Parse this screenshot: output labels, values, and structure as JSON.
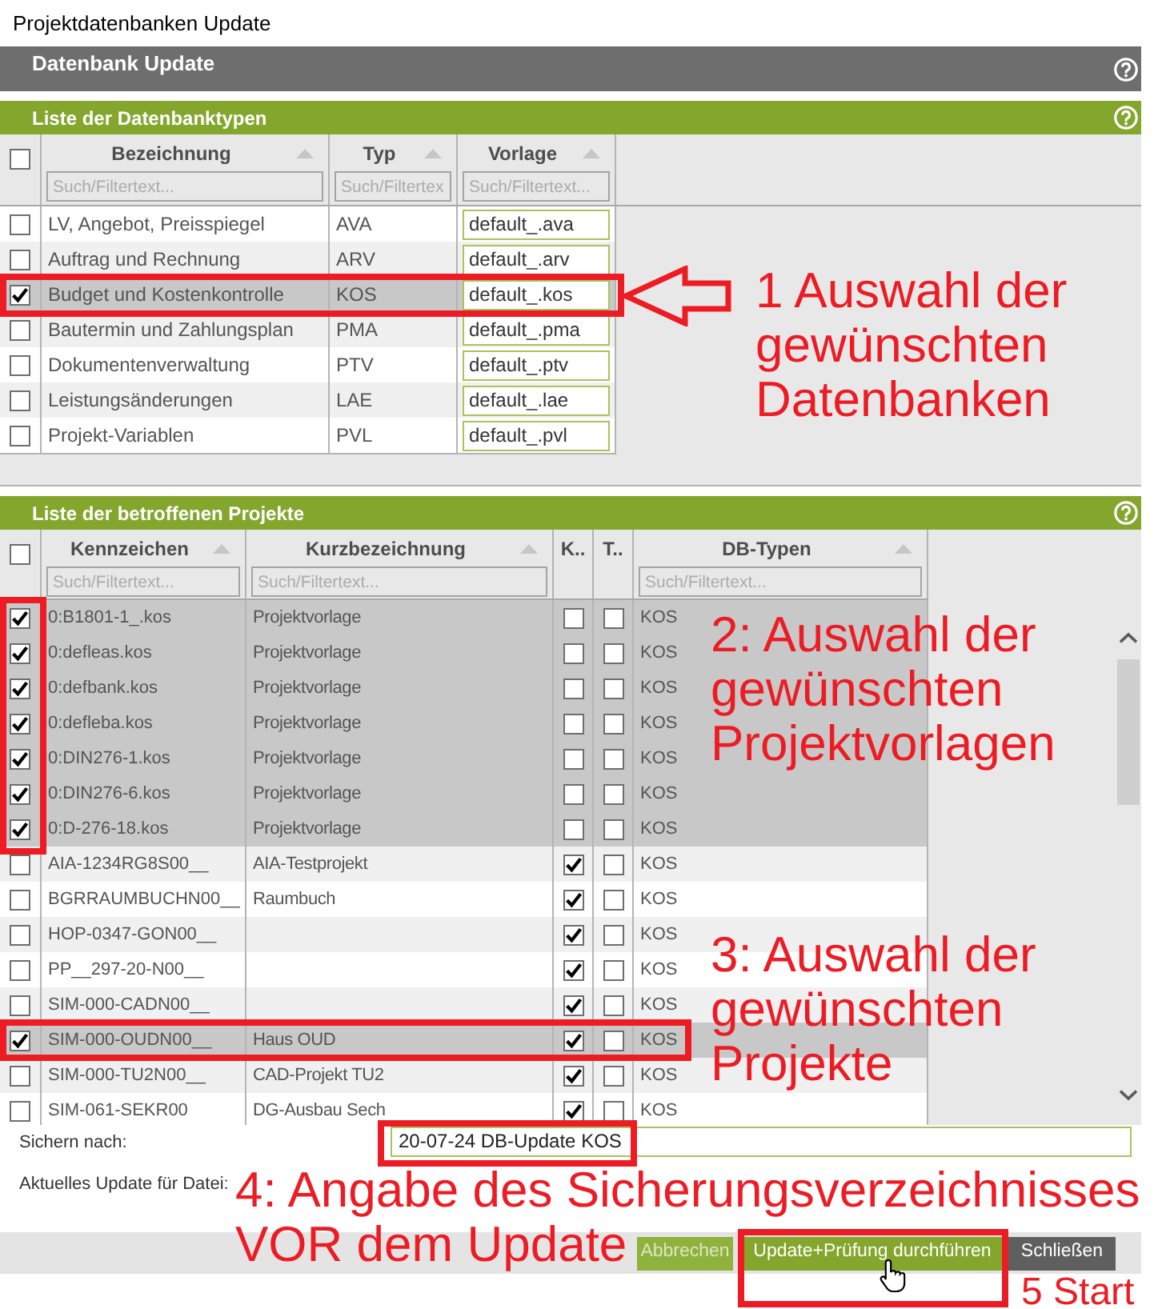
{
  "window": {
    "title": "Projektdatenbanken Update"
  },
  "header": {
    "title": "Datenbank Update"
  },
  "database_types": {
    "title": "Liste der Datenbanktypen",
    "select_all": {
      "checked": false
    },
    "columns": [
      {
        "label": "Bezeichnung",
        "sortable": true,
        "placeholder": "Such/Filtertext..."
      },
      {
        "label": "Typ",
        "sortable": true,
        "placeholder": "Such/Filtertex"
      },
      {
        "label": "Vorlage",
        "sortable": true,
        "placeholder": "Such/Filtertext..."
      }
    ],
    "rows": [
      {
        "name": "LV, Angebot, Preisspiegel",
        "type": "AVA",
        "template": "default_.ava",
        "checked": false,
        "selected": false
      },
      {
        "name": "Auftrag und Rechnung",
        "type": "ARV",
        "template": "default_.arv",
        "checked": false,
        "selected": false
      },
      {
        "name": "Budget und Kostenkontrolle",
        "type": "KOS",
        "template": "default_.kos",
        "checked": true,
        "selected": true
      },
      {
        "name": "Bautermin und Zahlungsplan",
        "type": "PMA",
        "template": "default_.pma",
        "checked": false,
        "selected": false
      },
      {
        "name": "Dokumentenverwaltung",
        "type": "PTV",
        "template": "default_.ptv",
        "checked": false,
        "selected": false
      },
      {
        "name": "Leistungsänderungen",
        "type": "LAE",
        "template": "default_.lae",
        "checked": false,
        "selected": false
      },
      {
        "name": "Projekt-Variablen",
        "type": "PVL",
        "template": "default_.pvl",
        "checked": false,
        "selected": false
      }
    ]
  },
  "projects": {
    "title": "Liste der betroffenen Projekte",
    "select_all": {
      "checked": false
    },
    "columns": [
      {
        "label": "Kennzeichen",
        "sortable": true,
        "placeholder": "Such/Filtertext..."
      },
      {
        "label": "Kurzbezeichnung",
        "sortable": true,
        "placeholder": "Such/Filtertext..."
      },
      {
        "label": "K..",
        "sortable": false
      },
      {
        "label": "T..",
        "sortable": false
      },
      {
        "label": "DB-Typen",
        "sortable": true,
        "placeholder": "Such/Filtertext..."
      }
    ],
    "rows": [
      {
        "code": "0:B1801-1_.kos",
        "short_name": "Projektvorlage",
        "column_k": false,
        "column_t": false,
        "db_types": "KOS",
        "checked": true,
        "selected": true
      },
      {
        "code": "0:defleas.kos",
        "short_name": "Projektvorlage",
        "column_k": false,
        "column_t": false,
        "db_types": "KOS",
        "checked": true,
        "selected": true
      },
      {
        "code": "0:defbank.kos",
        "short_name": "Projektvorlage",
        "column_k": false,
        "column_t": false,
        "db_types": "KOS",
        "checked": true,
        "selected": true
      },
      {
        "code": "0:defleba.kos",
        "short_name": "Projektvorlage",
        "column_k": false,
        "column_t": false,
        "db_types": "KOS",
        "checked": true,
        "selected": true
      },
      {
        "code": "0:DIN276-1.kos",
        "short_name": "Projektvorlage",
        "column_k": false,
        "column_t": false,
        "db_types": "KOS",
        "checked": true,
        "selected": true
      },
      {
        "code": "0:DIN276-6.kos",
        "short_name": "Projektvorlage",
        "column_k": false,
        "column_t": false,
        "db_types": "KOS",
        "checked": true,
        "selected": true
      },
      {
        "code": "0:D-276-18.kos",
        "short_name": "Projektvorlage",
        "column_k": false,
        "column_t": false,
        "db_types": "KOS",
        "checked": true,
        "selected": true
      },
      {
        "code": "AIA-1234RG8S00__",
        "short_name": "AIA-Testprojekt",
        "column_k": true,
        "column_t": false,
        "db_types": "KOS",
        "checked": false,
        "selected": false
      },
      {
        "code": "BGRRAUMBUCHN00__",
        "short_name": "Raumbuch",
        "column_k": true,
        "column_t": false,
        "db_types": "KOS",
        "checked": false,
        "selected": false
      },
      {
        "code": "HOP-0347-GON00__",
        "column_k": true,
        "column_t": false,
        "db_types": "KOS",
        "checked": false,
        "selected": false
      },
      {
        "code": "PP__297-20-N00__",
        "column_k": true,
        "column_t": false,
        "db_types": "KOS",
        "checked": false,
        "selected": false
      },
      {
        "code": "SIM-000-CADN00__",
        "column_k": true,
        "column_t": false,
        "db_types": "KOS",
        "checked": false,
        "selected": false
      },
      {
        "code": "SIM-000-OUDN00__",
        "short_name": "Haus OUD",
        "column_k": true,
        "column_t": false,
        "db_types": "KOS",
        "checked": true,
        "selected": true
      },
      {
        "code": "SIM-000-TU2N00__",
        "short_name": "CAD-Projekt TU2",
        "column_k": true,
        "column_t": false,
        "db_types": "KOS",
        "checked": false,
        "selected": false
      },
      {
        "code": "SIM-061-SEKR00",
        "short_name": "DG-Ausbau Sech",
        "column_k": true,
        "column_t": false,
        "db_types": "KOS",
        "checked": false,
        "selected": false
      }
    ]
  },
  "backup": {
    "label": "Sichern nach:",
    "value": "20-07-24 DB-Update KOS"
  },
  "current_file": {
    "label": "Aktuelles Update für Datei:"
  },
  "buttons": [
    {
      "label": "Abbrechen",
      "kind": "primary",
      "disabled": true
    },
    {
      "label": "Update+Prüfung durchführen",
      "kind": "primary",
      "disabled": false
    },
    {
      "label": "Schließen",
      "kind": "neutral",
      "disabled": false
    }
  ],
  "annotations": [
    {
      "text": "1 Auswahl der\ngewünschten\nDatenbanken"
    },
    {
      "text": "2: Auswahl der\ngewünschten\nProjektvorlagen"
    },
    {
      "text": "3: Auswahl der\ngewünschten\nProjekte"
    },
    {
      "text": "4: Angabe des Sicherungsverzeichnisses"
    },
    {
      "text": "VOR dem Update"
    },
    {
      "text": "5 Start"
    }
  ]
}
